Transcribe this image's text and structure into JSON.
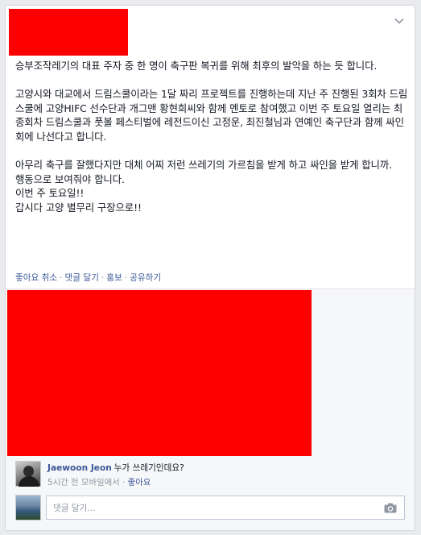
{
  "post": {
    "paragraphs": [
      [
        "승부조작레기의 대표 주자 중 한 명이 축구판 복귀를 위해 최후의 발악을 하는 듯 합니다."
      ],
      [
        "고양시와 대교에서 드림스쿨이라는 1달 짜리 프로젝트를 진행하는데 지난 주 진행된 3회차 드림스쿨에 고양HIFC 선수단과 개그맨 황현희씨와 함께 멘토로 참여했고 이번 주 토요일 열리는 최종회차 드림스쿨과 풋볼 페스티벌에 레전드이신 고정운, 최진철님과 연예인 축구단과 함께 싸인회에 나선다고 합니다."
      ],
      [
        "아무리 축구를 잘했다지만 대체 어찌 저런 쓰레기의 가르침을 받게 하고 싸인을 받게 합니까.",
        "행동으로 보여줘야 합니다.",
        "이번 주 토요일!!",
        "갑시다 고양 별무리 구장으로!!"
      ]
    ]
  },
  "actions": {
    "unlike": "좋아요 취소",
    "comment": "댓글 달기",
    "promote": "홍보",
    "share": "공유하기",
    "separator": "·"
  },
  "comment": {
    "author": "Jaewoon Jeon",
    "text": "누가 쓰레기인데요?",
    "time": "5시간 전 모바일에서",
    "separator": "·",
    "like": "좋아요"
  },
  "reply": {
    "placeholder": "댓글 달기..."
  },
  "icons": {
    "chevron": "chevron-down-icon",
    "camera": "camera-icon"
  },
  "colors": {
    "link": "#3b5998",
    "redaction": "#ff0000",
    "muted": "#9197a3"
  }
}
